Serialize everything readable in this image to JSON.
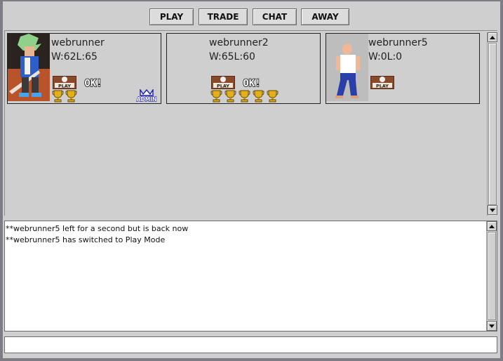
{
  "toolbar": {
    "buttons": [
      {
        "label": "PLAY"
      },
      {
        "label": "TRADE"
      },
      {
        "label": "CHAT"
      },
      {
        "label": "AWAY"
      }
    ]
  },
  "players": [
    {
      "name": "webrunner",
      "stats": "W:62L:65",
      "play_badge": "PLAY",
      "status": "OK!",
      "trophies": 2,
      "admin_badge": "ADMIN"
    },
    {
      "name": "webrunner2",
      "stats": "W:65L:60",
      "play_badge": "PLAY",
      "status": "OK!",
      "trophies": 5
    },
    {
      "name": "webrunner5",
      "stats": "W:0L:0",
      "play_badge": "PLAY",
      "trophies": 0
    }
  ],
  "chat": {
    "lines": [
      "**webrunner5 left for a second but is back now",
      "**webrunner5 has switched to Play Mode"
    ]
  },
  "input": {
    "value": ""
  },
  "colors": {
    "background": "#cfcfcf",
    "frame": "#7f7c85",
    "badge_blue": "#1b1bb5",
    "trophy_gold": "#e2b018"
  },
  "icons": [
    "player-avatar-icon",
    "play-badge-icon",
    "ok-badge-icon",
    "trophy-icon",
    "admin-badge-icon",
    "arrow-up-icon",
    "arrow-down-icon"
  ]
}
